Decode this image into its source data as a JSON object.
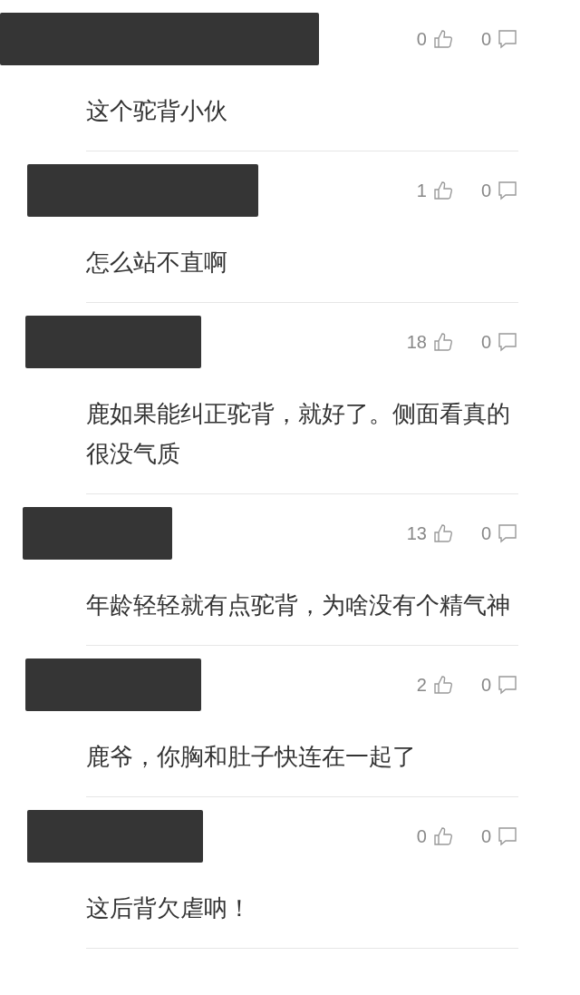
{
  "comments": [
    {
      "likes": "0",
      "replies": "0",
      "text": "这个驼背小伙"
    },
    {
      "likes": "1",
      "replies": "0",
      "text": "怎么站不直啊"
    },
    {
      "likes": "18",
      "replies": "0",
      "text": "鹿如果能纠正驼背，就好了。侧面看真的很没气质"
    },
    {
      "likes": "13",
      "replies": "0",
      "text": "年龄轻轻就有点驼背，为啥没有个精气神"
    },
    {
      "likes": "2",
      "replies": "0",
      "text": "鹿爷，你胸和肚子快连在一起了"
    },
    {
      "likes": "0",
      "replies": "0",
      "text": "这后背欠虐呐！"
    }
  ]
}
